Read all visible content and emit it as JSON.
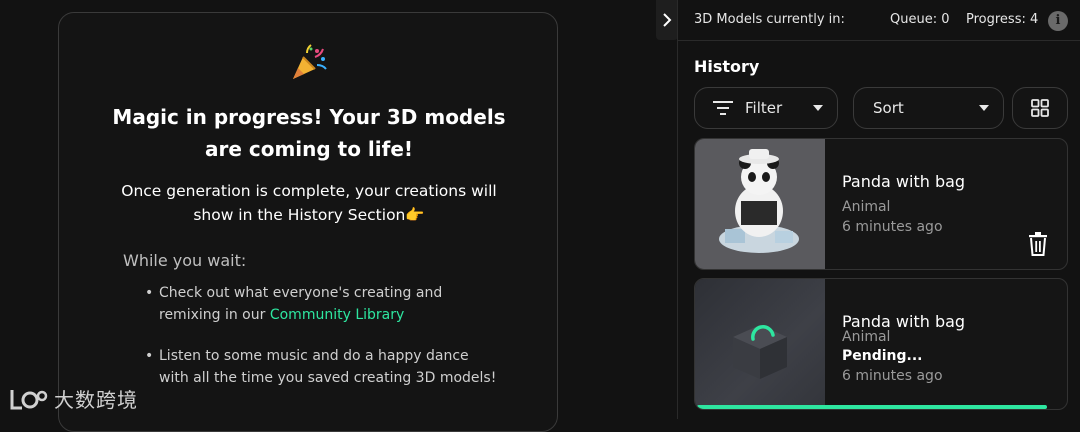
{
  "main_card": {
    "headline": "Magic in progress! Your 3D models are coming to life!",
    "subtext": "Once generation is complete, your creations will show in the History Section👉",
    "wait_title": "While you wait:",
    "tip1_text": "Check out what everyone's creating and remixing in our ",
    "tip1_link": "Community Library",
    "tip2_text": "Listen to some music and do a happy dance with all the time you saved creating 3D models!"
  },
  "status": {
    "label": "3D Models currently in:",
    "queue": "Queue: 0",
    "progress": "Progress: 4",
    "info_icon": "i"
  },
  "history": {
    "title": "History",
    "filter_label": "Filter",
    "sort_label": "Sort",
    "items": [
      {
        "name": "Panda with bag",
        "category": "Animal",
        "time": "6 minutes ago"
      },
      {
        "name": "Panda with bag",
        "category": "Animal",
        "status": "Pending...",
        "time": "6 minutes ago"
      }
    ]
  },
  "watermark": {
    "text": "大数跨境"
  },
  "colors": {
    "accent": "#2ee6a0",
    "background": "#121212",
    "card_border": "#3a3a3a"
  },
  "icons": [
    "party-popper-icon",
    "chevron-right-icon",
    "info-icon",
    "filter-icon",
    "grid-view-icon",
    "trash-icon",
    "loading-cube-icon"
  ]
}
